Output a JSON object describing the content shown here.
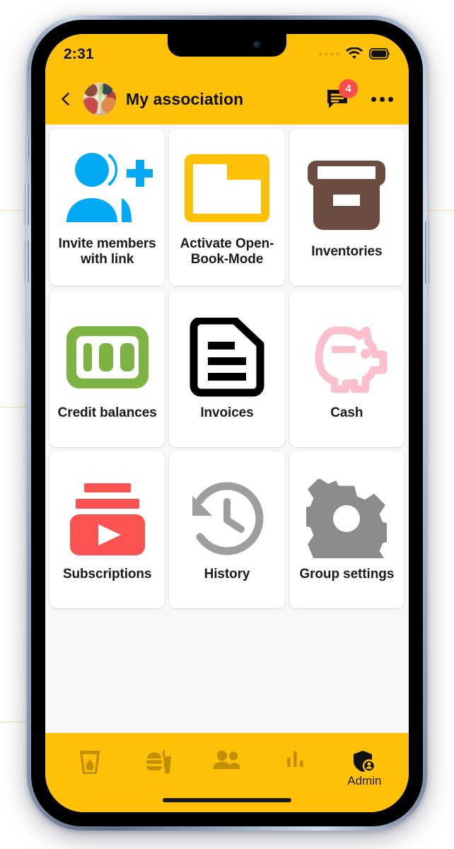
{
  "status_bar": {
    "time": "2:31",
    "signal_icon": "signal-dots-icon",
    "wifi_icon": "wifi-icon",
    "battery_icon": "battery-full-icon"
  },
  "app_bar": {
    "back_icon": "back-chevron-icon",
    "avatar_icon": "group-avatar-photo",
    "title": "My association",
    "chat_icon": "chat-bubble-icon",
    "chat_badge_count": "4",
    "overflow_icon": "more-options-icon"
  },
  "colors": {
    "brand_yellow": "#FFC107",
    "badge_red": "#FF4B4B",
    "invite_blue": "#02A9F4",
    "folder_yellow": "#FFC107",
    "inventory_brown": "#6B4C41",
    "credit_green": "#7CB342",
    "invoice_black": "#000000",
    "cash_pink": "#FBC0CB",
    "subscription_red": "#FB5252",
    "history_gray": "#9E9E9E",
    "settings_gray": "#8C8C8C",
    "tile_background": "#FFFFFF",
    "page_background": "#F7F7F7"
  },
  "grid": {
    "tiles": [
      {
        "id": "invite-members",
        "label": "Invite members with link",
        "icon": "person-add-icon",
        "color": "#02A9F4"
      },
      {
        "id": "activate-open-book-mode",
        "label": "Activate Open-Book-Mode",
        "icon": "folder-icon",
        "color": "#FFC107"
      },
      {
        "id": "inventories",
        "label": "Inventories",
        "icon": "archive-box-icon",
        "color": "#6B4C41"
      },
      {
        "id": "credit-balances",
        "label": "Credit balances",
        "icon": "banknote-100-icon",
        "color": "#7CB342"
      },
      {
        "id": "invoices",
        "label": "Invoices",
        "icon": "document-lines-icon",
        "color": "#000000"
      },
      {
        "id": "cash",
        "label": "Cash",
        "icon": "piggy-bank-icon",
        "color": "#FBC0CB"
      },
      {
        "id": "subscriptions",
        "label": "Subscriptions",
        "icon": "subscriptions-play-icon",
        "color": "#FB5252"
      },
      {
        "id": "history",
        "label": "History",
        "icon": "history-clock-icon",
        "color": "#9E9E9E"
      },
      {
        "id": "group-settings",
        "label": "Group settings",
        "icon": "gear-icon",
        "color": "#8C8C8C"
      }
    ]
  },
  "bottom_nav": {
    "items": [
      {
        "id": "drinks",
        "icon": "drink-glass-icon",
        "label": ""
      },
      {
        "id": "food",
        "icon": "fast-food-icon",
        "label": ""
      },
      {
        "id": "members",
        "icon": "people-icon",
        "label": ""
      },
      {
        "id": "statistics",
        "icon": "bar-chart-icon",
        "label": ""
      },
      {
        "id": "admin",
        "icon": "shield-person-icon",
        "label": "Admin"
      }
    ]
  }
}
